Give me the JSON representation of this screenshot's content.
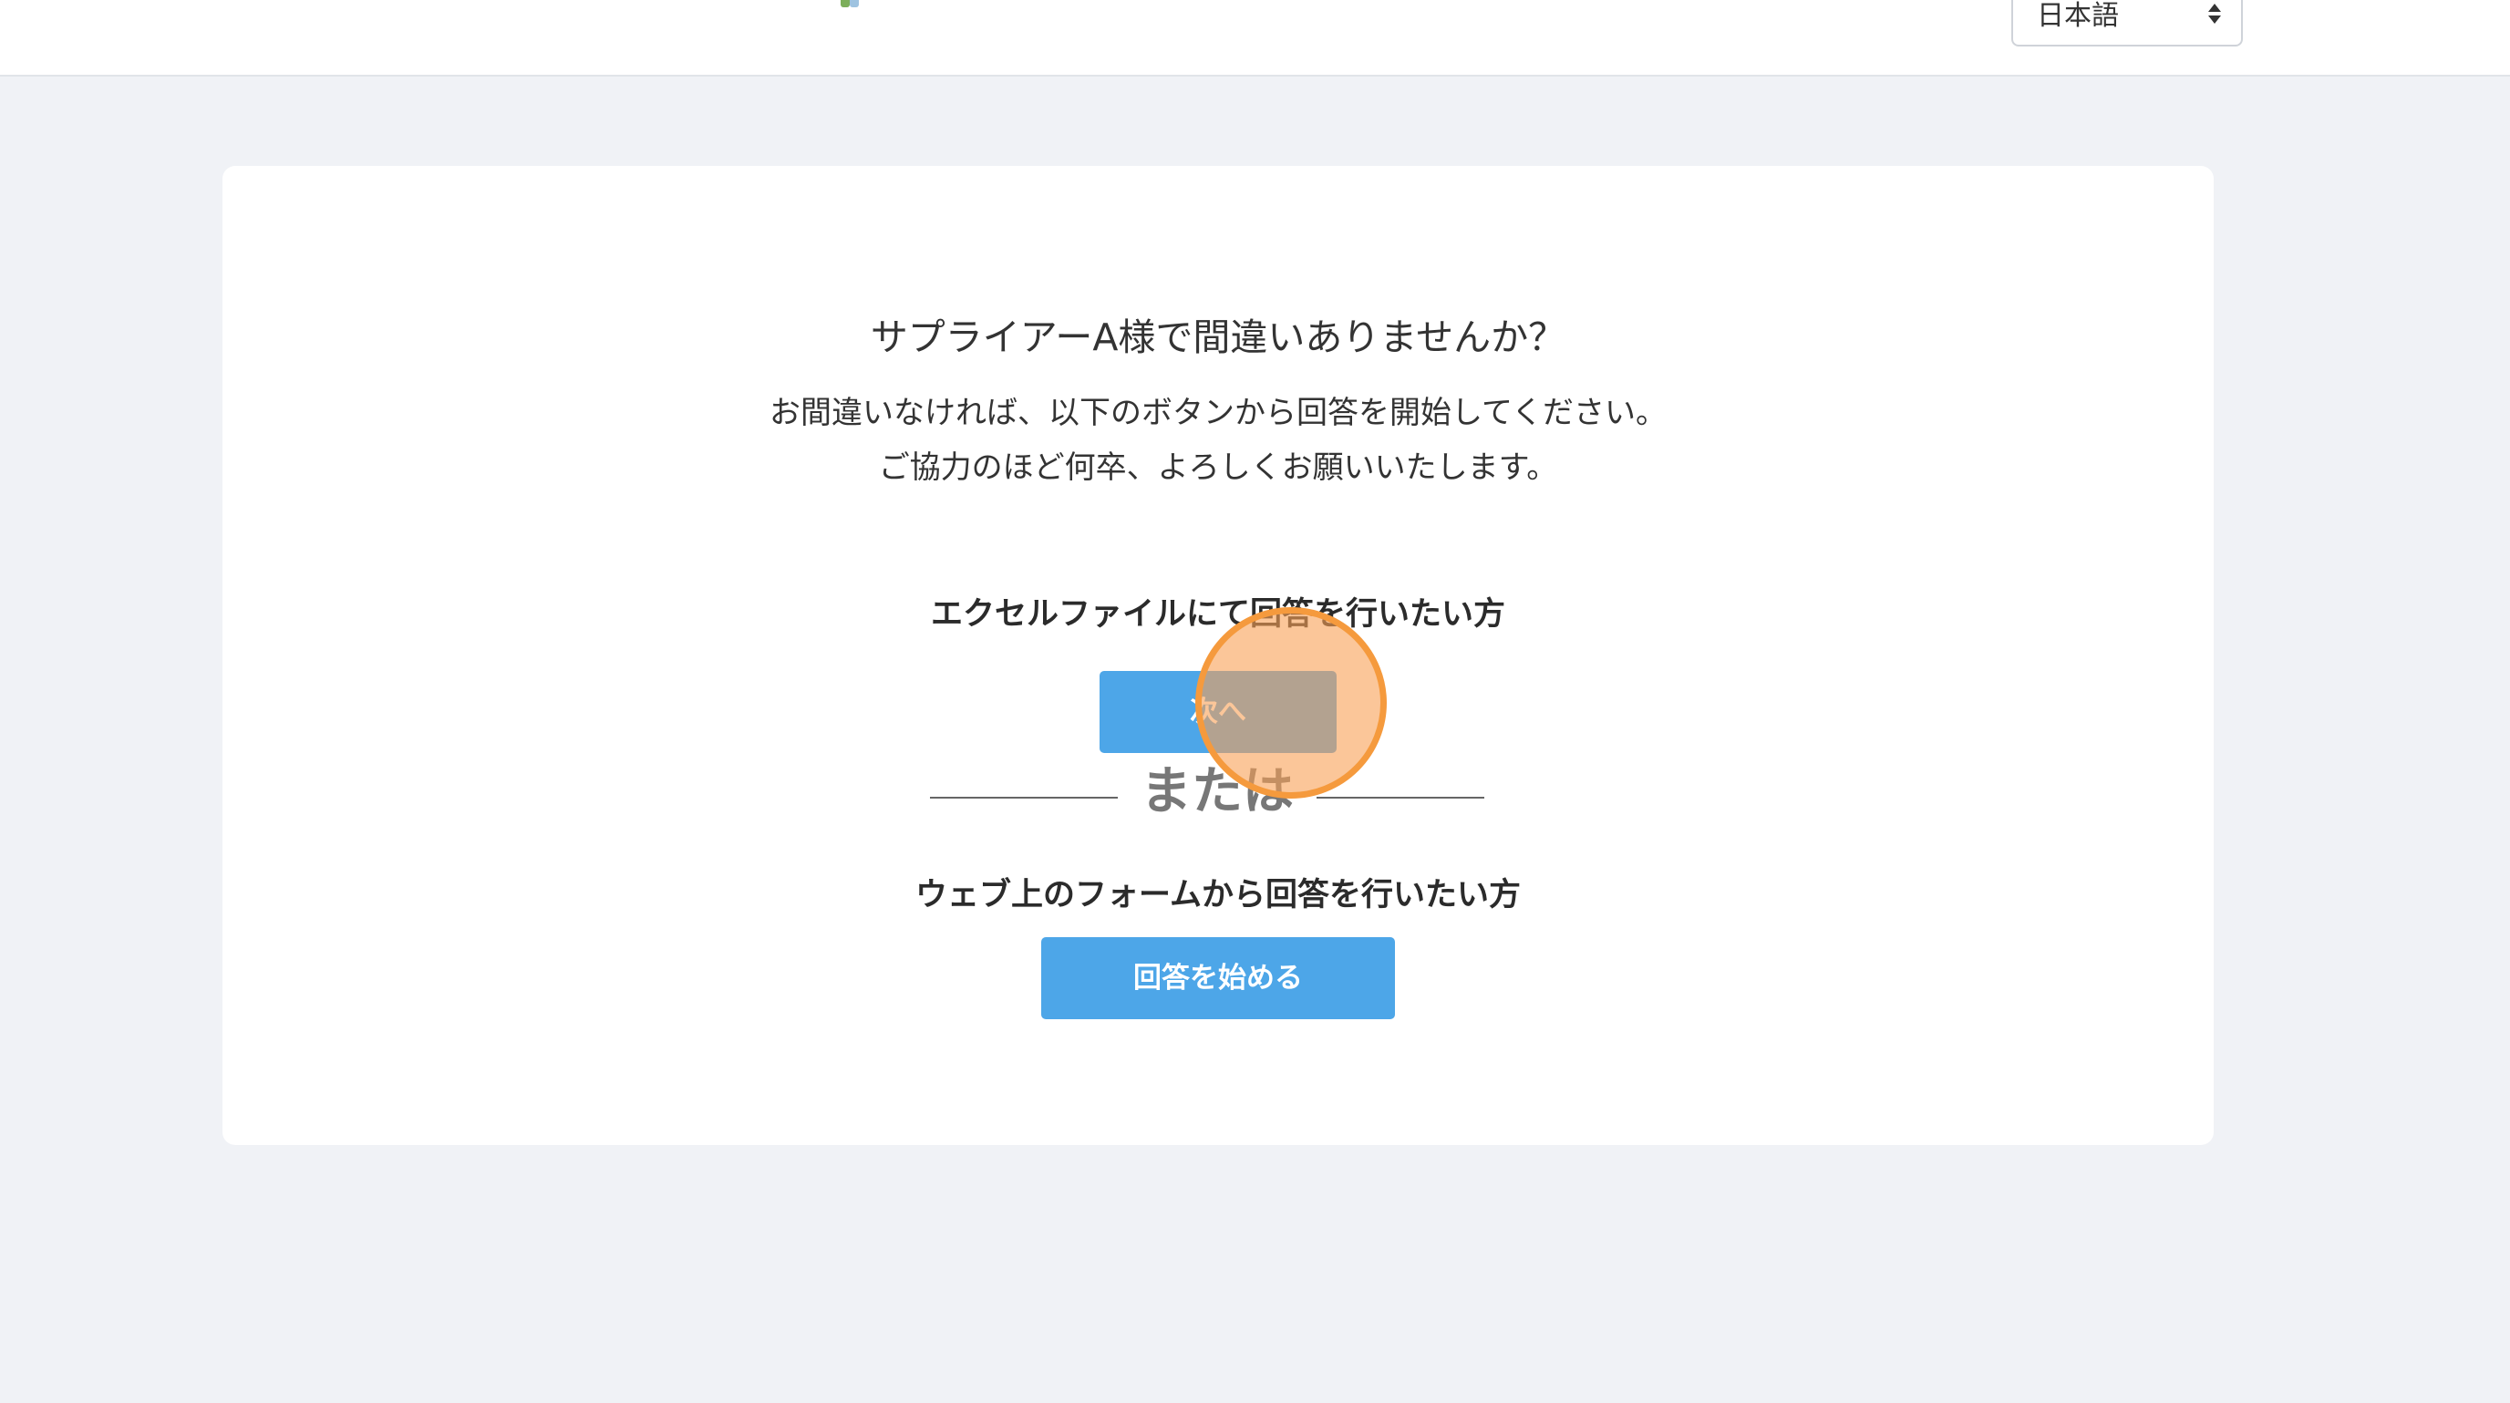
{
  "header": {
    "language_select": {
      "value": "日本語"
    }
  },
  "card": {
    "confirm_title": "サプライアーA様で間違いありませんか？",
    "instruction_line1": "お間違いなければ、以下のボタンから回答を開始してください。",
    "instruction_line2": "ご協力のほど何卒、よろしくお願いいたします。",
    "excel_section": {
      "heading": "エクセルファイルにて回答を行いたい方",
      "button_label": "次へ"
    },
    "divider_label": "または",
    "web_section": {
      "heading": "ウェブ上のフォームから回答を行いたい方",
      "button_label": "回答を始める"
    }
  },
  "colors": {
    "page_background": "#f0f2f6",
    "primary_button": "#4da6e8",
    "click_indicator": "#f59a3d"
  }
}
